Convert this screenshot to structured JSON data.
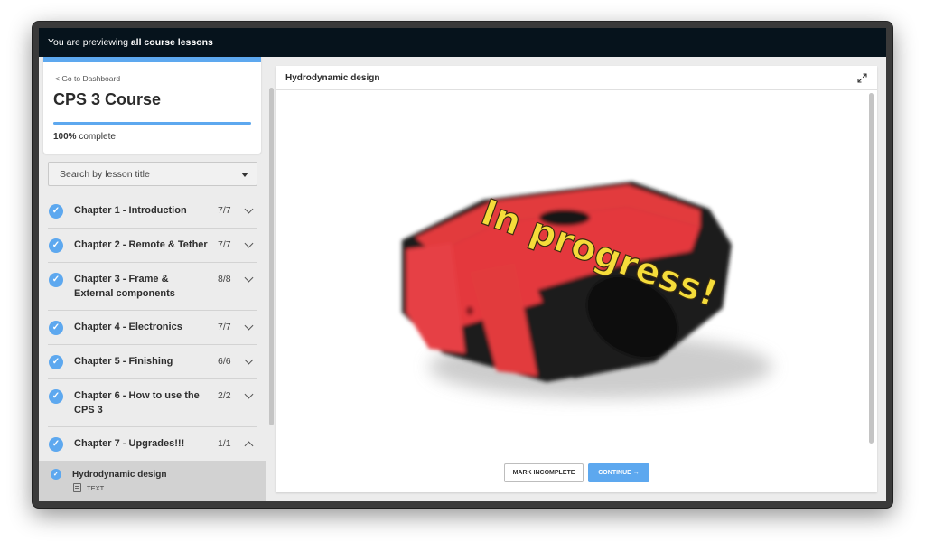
{
  "banner": {
    "prefix": "You are previewing ",
    "emphasis": "all course lessons"
  },
  "sidebar": {
    "dashboard_link": "< Go to Dashboard",
    "course_title": "CPS 3 Course",
    "progress_percent": 100,
    "progress_value": "100%",
    "progress_suffix": " complete",
    "search_placeholder": "Search by lesson title",
    "chapters": [
      {
        "title": "Chapter 1 - Introduction",
        "count": "7/7",
        "expanded": false
      },
      {
        "title": "Chapter 2 - Remote & Tether",
        "count": "7/7",
        "expanded": false
      },
      {
        "title": "Chapter 3 - Frame & External components",
        "count": "8/8",
        "expanded": false
      },
      {
        "title": "Chapter 4 - Electronics",
        "count": "7/7",
        "expanded": false
      },
      {
        "title": "Chapter 5 - Finishing",
        "count": "6/6",
        "expanded": false
      },
      {
        "title": "Chapter 6 - How to use the CPS 3",
        "count": "2/2",
        "expanded": false
      },
      {
        "title": "Chapter 7 - Upgrades!!!",
        "count": "1/1",
        "expanded": true
      }
    ],
    "active_lesson": {
      "title": "Hydrodynamic design",
      "type": "TEXT"
    }
  },
  "content": {
    "title": "Hydrodynamic design",
    "image_overlay": "In progress!",
    "mark_incomplete_label": "MARK INCOMPLETE",
    "continue_label": "CONTINUE →"
  },
  "colors": {
    "accent": "#5da8ef",
    "banner_bg": "#06131c",
    "drone_red": "#e23a3e",
    "overlay_yellow": "#f5dc3a"
  }
}
